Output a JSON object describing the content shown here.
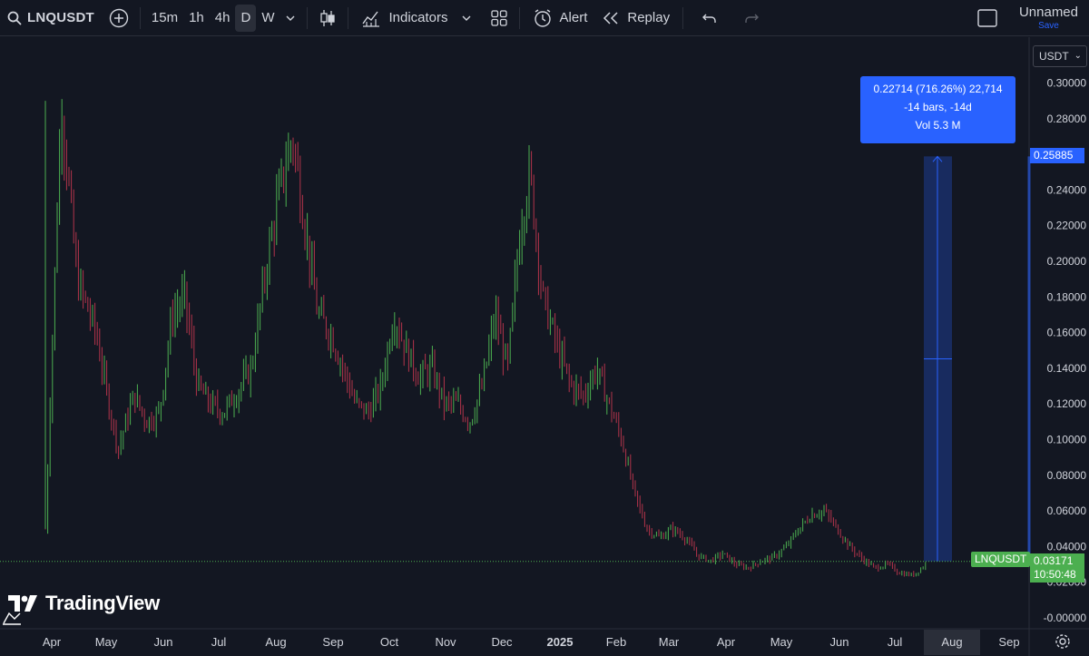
{
  "toolbar": {
    "symbol": "LNQUSDT",
    "intervals": [
      "15m",
      "1h",
      "4h",
      "D",
      "W"
    ],
    "active_interval": "D",
    "indicators_label": "Indicators",
    "alert_label": "Alert",
    "replay_label": "Replay",
    "layout_name": "Unnamed",
    "save_label": "Save"
  },
  "currency_selector": {
    "value": "USDT"
  },
  "measure": {
    "line1": "0.22714 (716.26%) 22,714",
    "line2": "-14 bars, -14d",
    "line3": "Vol 5.3 M",
    "top_price": "0.25885"
  },
  "last_price": {
    "symbol_label": "LNQUSDT",
    "price": "0.03171",
    "countdown": "10:50:48"
  },
  "brand": {
    "name": "TradingView"
  },
  "colors": {
    "background": "#131722",
    "up": "#4caf50",
    "down": "#b2344a",
    "accent": "#2962ff",
    "grid": "#1e222d",
    "text": "#d1d4dc"
  },
  "chart_data": {
    "type": "ohlc-bar",
    "y_axis_ticks": [
      "0.30000",
      "0.28000",
      "0.24000",
      "0.22000",
      "0.20000",
      "0.18000",
      "0.16000",
      "0.14000",
      "0.12000",
      "0.10000",
      "0.08000",
      "0.06000",
      "0.04000",
      "0.02000",
      "-0.00000"
    ],
    "ylim": [
      0,
      0.3
    ],
    "x_axis_labels": [
      "Apr",
      "May",
      "Jun",
      "Jul",
      "Aug",
      "Sep",
      "Oct",
      "Nov",
      "Dec",
      "2025",
      "Feb",
      "Mar",
      "Apr",
      "May",
      "Jun",
      "Jul",
      "Aug",
      "Sep"
    ],
    "highlighted_x_label": "Aug",
    "last_price": 0.03171,
    "measure_top": 0.25885,
    "price_path": [
      {
        "x": 0.0,
        "y": 0.05
      },
      {
        "x": 0.5,
        "y": 0.29
      },
      {
        "x": 1.0,
        "y": 0.19
      },
      {
        "x": 1.6,
        "y": 0.16
      },
      {
        "x": 2.0,
        "y": 0.12
      },
      {
        "x": 2.3,
        "y": 0.095
      },
      {
        "x": 2.8,
        "y": 0.125
      },
      {
        "x": 3.2,
        "y": 0.11
      },
      {
        "x": 3.6,
        "y": 0.115
      },
      {
        "x": 4.0,
        "y": 0.17
      },
      {
        "x": 4.4,
        "y": 0.18
      },
      {
        "x": 4.8,
        "y": 0.13
      },
      {
        "x": 5.2,
        "y": 0.12
      },
      {
        "x": 5.6,
        "y": 0.115
      },
      {
        "x": 6.0,
        "y": 0.125
      },
      {
        "x": 6.5,
        "y": 0.14
      },
      {
        "x": 7.0,
        "y": 0.2
      },
      {
        "x": 7.4,
        "y": 0.24
      },
      {
        "x": 7.8,
        "y": 0.27
      },
      {
        "x": 8.2,
        "y": 0.22
      },
      {
        "x": 8.6,
        "y": 0.17
      },
      {
        "x": 9.0,
        "y": 0.16
      },
      {
        "x": 9.4,
        "y": 0.14
      },
      {
        "x": 9.8,
        "y": 0.12
      },
      {
        "x": 10.2,
        "y": 0.115
      },
      {
        "x": 10.6,
        "y": 0.13
      },
      {
        "x": 11.0,
        "y": 0.17
      },
      {
        "x": 11.4,
        "y": 0.15
      },
      {
        "x": 11.8,
        "y": 0.135
      },
      {
        "x": 12.2,
        "y": 0.14
      },
      {
        "x": 12.6,
        "y": 0.12
      },
      {
        "x": 13.0,
        "y": 0.12
      },
      {
        "x": 13.4,
        "y": 0.11
      },
      {
        "x": 13.8,
        "y": 0.13
      },
      {
        "x": 14.2,
        "y": 0.17
      },
      {
        "x": 14.6,
        "y": 0.14
      },
      {
        "x": 15.0,
        "y": 0.22
      },
      {
        "x": 15.3,
        "y": 0.25
      },
      {
        "x": 15.7,
        "y": 0.18
      },
      {
        "x": 16.2,
        "y": 0.15
      },
      {
        "x": 16.6,
        "y": 0.13
      },
      {
        "x": 17.0,
        "y": 0.125
      },
      {
        "x": 17.4,
        "y": 0.14
      },
      {
        "x": 17.8,
        "y": 0.12
      },
      {
        "x": 18.2,
        "y": 0.1
      },
      {
        "x": 18.6,
        "y": 0.07
      },
      {
        "x": 19.0,
        "y": 0.05
      },
      {
        "x": 19.4,
        "y": 0.045
      },
      {
        "x": 19.8,
        "y": 0.05
      },
      {
        "x": 20.2,
        "y": 0.045
      },
      {
        "x": 20.6,
        "y": 0.035
      },
      {
        "x": 21.0,
        "y": 0.032
      },
      {
        "x": 21.4,
        "y": 0.036
      },
      {
        "x": 21.8,
        "y": 0.03
      },
      {
        "x": 22.2,
        "y": 0.028
      },
      {
        "x": 22.6,
        "y": 0.032
      },
      {
        "x": 23.0,
        "y": 0.034
      },
      {
        "x": 23.4,
        "y": 0.04
      },
      {
        "x": 23.8,
        "y": 0.05
      },
      {
        "x": 24.2,
        "y": 0.058
      },
      {
        "x": 24.6,
        "y": 0.06
      },
      {
        "x": 25.0,
        "y": 0.05
      },
      {
        "x": 25.4,
        "y": 0.04
      },
      {
        "x": 25.8,
        "y": 0.033
      },
      {
        "x": 26.2,
        "y": 0.028
      },
      {
        "x": 26.6,
        "y": 0.03
      },
      {
        "x": 27.0,
        "y": 0.025
      },
      {
        "x": 27.4,
        "y": 0.024
      },
      {
        "x": 27.8,
        "y": 0.03
      }
    ]
  }
}
